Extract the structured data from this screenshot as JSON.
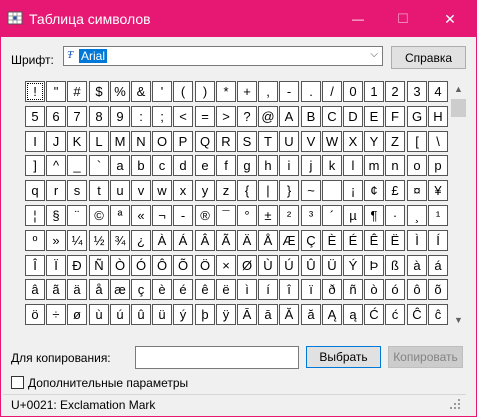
{
  "window": {
    "title": "Таблица символов",
    "controls": {
      "minimize": "—",
      "maximize": "☐",
      "close": "✕"
    }
  },
  "font": {
    "label": "Шрифт:",
    "value": "Arial",
    "help_button": "Справка"
  },
  "grid": {
    "columns": 20,
    "rows": [
      [
        "!",
        "\"",
        "#",
        "$",
        "%",
        "&",
        "'",
        "(",
        ")",
        "*",
        "+",
        ",",
        "-",
        ".",
        "/",
        "0",
        "1",
        "2",
        "3",
        "4"
      ],
      [
        "5",
        "6",
        "7",
        "8",
        "9",
        ":",
        ";",
        "<",
        "=",
        ">",
        "?",
        "@",
        "A",
        "B",
        "C",
        "D",
        "E",
        "F",
        "G",
        "H"
      ],
      [
        "I",
        "J",
        "K",
        "L",
        "M",
        "N",
        "O",
        "P",
        "Q",
        "R",
        "S",
        "T",
        "U",
        "V",
        "W",
        "X",
        "Y",
        "Z",
        "[",
        "\\"
      ],
      [
        "]",
        "^",
        "_",
        "`",
        "a",
        "b",
        "c",
        "d",
        "e",
        "f",
        "g",
        "h",
        "i",
        "j",
        "k",
        "l",
        "m",
        "n",
        "o",
        "p"
      ],
      [
        "q",
        "r",
        "s",
        "t",
        "u",
        "v",
        "w",
        "x",
        "y",
        "z",
        "{",
        "|",
        "}",
        "~",
        " ",
        "¡",
        "¢",
        "£",
        "¤",
        "¥"
      ],
      [
        "¦",
        "§",
        "¨",
        "©",
        "ª",
        "«",
        "¬",
        "-",
        "®",
        "¯",
        "°",
        "±",
        "²",
        "³",
        "´",
        "µ",
        "¶",
        "·",
        "¸",
        "¹"
      ],
      [
        "º",
        "»",
        "¼",
        "½",
        "¾",
        "¿",
        "À",
        "Á",
        "Â",
        "Ã",
        "Ä",
        "Å",
        "Æ",
        "Ç",
        "È",
        "É",
        "Ê",
        "Ë",
        "Ì",
        "Í"
      ],
      [
        "Î",
        "Ï",
        "Ð",
        "Ñ",
        "Ò",
        "Ó",
        "Ô",
        "Õ",
        "Ö",
        "×",
        "Ø",
        "Ù",
        "Ú",
        "Û",
        "Ü",
        "Ý",
        "Þ",
        "ß",
        "à",
        "á"
      ],
      [
        "â",
        "ã",
        "ä",
        "å",
        "æ",
        "ç",
        "è",
        "é",
        "ê",
        "ë",
        "ì",
        "í",
        "î",
        "ï",
        "ð",
        "ñ",
        "ò",
        "ó",
        "ô",
        "õ"
      ],
      [
        "ö",
        "÷",
        "ø",
        "ù",
        "ú",
        "û",
        "ü",
        "ý",
        "þ",
        "ÿ",
        "Ā",
        "ā",
        "Ă",
        "ă",
        "Ą",
        "ą",
        "Ć",
        "ć",
        "Ĉ",
        "ĉ"
      ]
    ],
    "selected": "!"
  },
  "scrollbar": {
    "up": "▲",
    "down": "▼"
  },
  "copy": {
    "label": "Для копирования:",
    "value": "",
    "select_button": "Выбрать",
    "copy_button": "Копировать"
  },
  "advanced": {
    "label": "Дополнительные параметры",
    "checked": false
  },
  "status": {
    "text": "U+0021: Exclamation Mark"
  },
  "colors": {
    "titlebar": "#e61874",
    "selection": "#0078d7"
  }
}
